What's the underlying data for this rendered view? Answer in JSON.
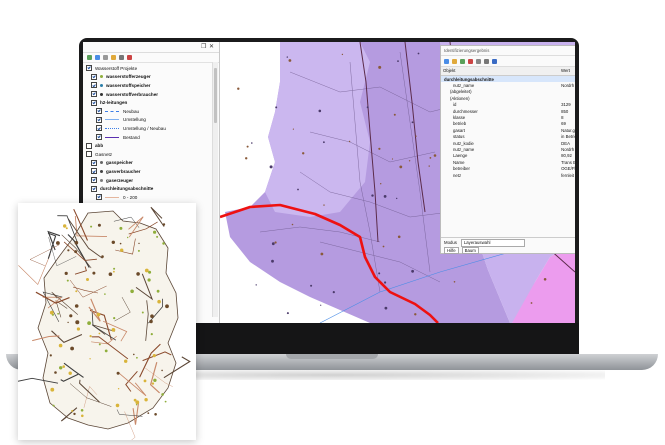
{
  "colors": {
    "map_purple": "#b59be0",
    "map_lavender": "#c9b5ee",
    "map_magenta": "#e793e8",
    "route_red": "#ee1111",
    "selection_blue": "#d7e6fb"
  },
  "layer_panel": {
    "title_icons": [
      "float-icon",
      "close-icon"
    ],
    "root_group": "Wasserstoff Projekte",
    "items": [
      {
        "label": "wasserstofferzeuger",
        "bold": true,
        "checked": true,
        "dot": "#8fae3b",
        "indent": 1
      },
      {
        "label": "wasserstoffspeicher",
        "bold": true,
        "checked": true,
        "dot": "#2a7ea8",
        "indent": 1
      },
      {
        "label": "wasserstoffverbraucher",
        "bold": true,
        "checked": true,
        "dot": "#333333",
        "indent": 1
      },
      {
        "label": "h2-leitungen",
        "bold": true,
        "checked": true,
        "dot": "",
        "indent": 1
      },
      {
        "label": "Neubau",
        "bold": false,
        "checked": true,
        "line": "#3d7ee6",
        "dash": "dashed",
        "indent": 2
      },
      {
        "label": "Umstellung",
        "bold": false,
        "checked": true,
        "line": "#7fb0f0",
        "dash": "solid",
        "indent": 2
      },
      {
        "label": "Umstellung / Neubau",
        "bold": false,
        "checked": true,
        "line": "#3d7ee6",
        "dash": "dotted",
        "indent": 2
      },
      {
        "label": "Bestand",
        "bold": false,
        "checked": true,
        "line": "#5a2fb0",
        "dash": "solid",
        "indent": 2
      },
      {
        "label": "abb",
        "bold": true,
        "checked": false,
        "dot": "",
        "indent": 0
      },
      {
        "label": "Gasnetz",
        "bold": false,
        "checked": false,
        "dot": "",
        "indent": 0
      },
      {
        "label": "gasspeicher",
        "bold": true,
        "checked": true,
        "dot": "#666666",
        "indent": 1
      },
      {
        "label": "gasverbraucher",
        "bold": true,
        "checked": true,
        "dot": "#444444",
        "indent": 1
      },
      {
        "label": "gaserzeuger",
        "bold": true,
        "checked": true,
        "dot": "#7c7c7c",
        "indent": 1
      },
      {
        "label": "durchleitungsabschnitte",
        "bold": true,
        "checked": true,
        "dot": "",
        "indent": 1
      },
      {
        "label": "0 - 200",
        "bold": false,
        "checked": true,
        "line": "#e6b7a0",
        "dash": "solid",
        "indent": 2
      },
      {
        "label": "200 - 400",
        "bold": false,
        "checked": true,
        "line": "#c98a6b",
        "dash": "solid",
        "indent": 2
      },
      {
        "label": "400 - 600",
        "bold": false,
        "checked": true,
        "line": "#8a4a2c",
        "dash": "solid",
        "indent": 2
      }
    ]
  },
  "identify_panel": {
    "title": "Identifizierungsergebnis",
    "col_object": "Objekt",
    "col_value": "Wert",
    "selected_layer": "durchleitungsabschnitte",
    "rows": [
      {
        "k": "nutz_name",
        "v": "Nordrh"
      },
      {
        "k": "(abgeleitet)",
        "v": ""
      },
      {
        "k": "(Aktionen)",
        "v": ""
      },
      {
        "k": "id",
        "v": "3129"
      },
      {
        "k": "durchmesser",
        "v": "850"
      },
      {
        "k": "klasse",
        "v": "8"
      },
      {
        "k": "betrieb",
        "v": "69"
      },
      {
        "k": "gasart",
        "v": "Natur.g"
      },
      {
        "k": "status",
        "v": "in Betrie"
      },
      {
        "k": "nutz_kodie",
        "v": "DEA"
      },
      {
        "k": "nutz_name",
        "v": "Nordrh"
      },
      {
        "k": "Laenge",
        "v": "80,92"
      },
      {
        "k": "Name",
        "v": "Trans E"
      },
      {
        "k": "betreiber",
        "v": "OGE/Fl"
      },
      {
        "k": "netz",
        "v": "fernleit"
      }
    ],
    "mode_label": "Modus",
    "mode_value": "Layerauswahl",
    "help_button": "Hilfe",
    "view_label": "Baum"
  }
}
